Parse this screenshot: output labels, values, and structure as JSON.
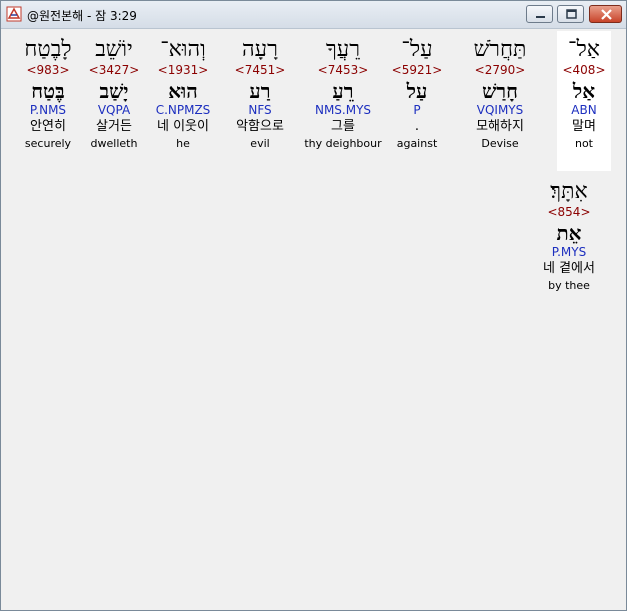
{
  "window": {
    "title": "@원전본해 - 잠 3:29"
  },
  "words": [
    {
      "heb": "אַל־",
      "strong": "<408>",
      "root": "אַל",
      "parse": "ABN",
      "kor": "말며",
      "eng": "not",
      "selected": true
    },
    {
      "heb": "תַּחֲרֹשׁ",
      "strong": "<2790>",
      "root": "חָרַשׁ",
      "parse": "VQIMYS",
      "kor": "모해하지",
      "eng": "Devise",
      "selected": false
    },
    {
      "heb": "עַל־",
      "strong": "<5921>",
      "root": "עַל",
      "parse": "P",
      "kor": ".",
      "eng": "against",
      "selected": false
    },
    {
      "heb": "רֵעֲךָ",
      "strong": "<7453>",
      "root": "רֵעַ",
      "parse": "NMS.MYS",
      "kor": "그를",
      "eng": "thy deighbour",
      "selected": false
    },
    {
      "heb": "רָעָה",
      "strong": "<7451>",
      "root": "רַע",
      "parse": "NFS",
      "kor": "악함으로",
      "eng": "evil",
      "selected": false
    },
    {
      "heb": "וְהוּא־",
      "strong": "<1931>",
      "root": "הוּא",
      "parse": "C.NPMZS",
      "kor": "네 이웃이",
      "eng": "he",
      "selected": false
    },
    {
      "heb": "יוֹשֵׁב",
      "strong": "<3427>",
      "root": "יָשַׁב",
      "parse": "VQPA",
      "kor": "살거든",
      "eng": "dwelleth",
      "selected": false
    },
    {
      "heb": "לָבֶטַח",
      "strong": "<983>",
      "root": "בֶּטַח",
      "parse": "P.NMS",
      "kor": "안연히",
      "eng": "securely",
      "selected": false
    },
    {
      "heb": "אִתָּךְ׃",
      "strong": "<854>",
      "root": "אֵת",
      "parse": "P.MYS",
      "kor": "네 곁에서",
      "eng": "by thee",
      "selected": false
    }
  ]
}
